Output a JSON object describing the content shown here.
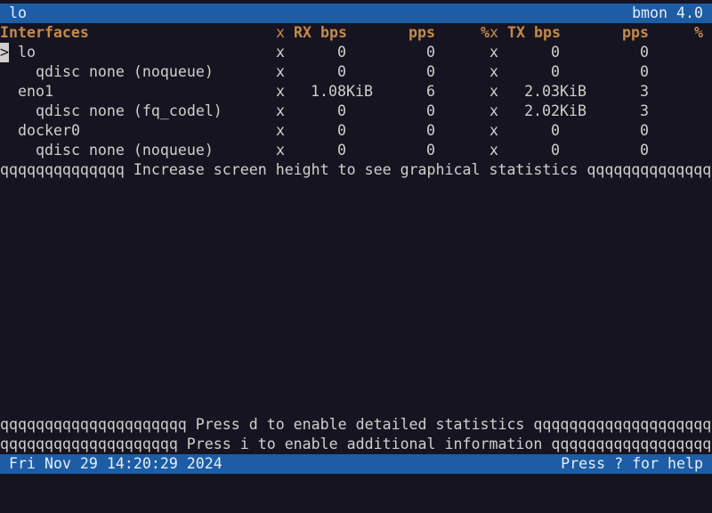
{
  "title_bar": {
    "left": "lo",
    "right": "bmon 4.0"
  },
  "header": {
    "interfaces": "Interfaces",
    "x1": "x",
    "rx_bps": "RX bps",
    "rx_pps": "pps",
    "rx_pct": "%",
    "x2": "x",
    "tx_bps": "TX bps",
    "tx_pps": "pps",
    "tx_pct": "%"
  },
  "cursor_marker": ">",
  "rows": [
    {
      "name": "lo",
      "rx_bps": "0",
      "rx_pps": "0",
      "tx_bps": "0",
      "tx_pps": "0"
    },
    {
      "name": "qdisc none (noqueue)",
      "rx_bps": "0",
      "rx_pps": "0",
      "tx_bps": "0",
      "tx_pps": "0"
    },
    {
      "name": "eno1",
      "rx_bps": "1.08KiB",
      "rx_pps": "6",
      "tx_bps": "2.03KiB",
      "tx_pps": "3"
    },
    {
      "name": "qdisc none (fq_codel)",
      "rx_bps": "0",
      "rx_pps": "0",
      "tx_bps": "2.02KiB",
      "tx_pps": "3"
    },
    {
      "name": "docker0",
      "rx_bps": "0",
      "rx_pps": "0",
      "tx_bps": "0",
      "tx_pps": "0"
    },
    {
      "name": "qdisc none (noqueue)",
      "rx_bps": "0",
      "rx_pps": "0",
      "tx_bps": "0",
      "tx_pps": "0"
    }
  ],
  "separator_x": "x",
  "messages": {
    "graph": "qqqqqqqqqqqqqq Increase screen height to see graphical statistics qqqqqqqqqqqqqqqq",
    "details": "qqqqqqqqqqqqqqqqqqqqq Press d to enable detailed statistics qqqqqqqqqqqqqqqqqqqqqqq",
    "info": "qqqqqqqqqqqqqqqqqqqq Press i to enable additional information qqqqqqqqqqqqqqqqqqqqqq"
  },
  "status_bar": {
    "datetime": "Fri Nov 29 14:20:29 2024",
    "help": "Press ? for help"
  },
  "colors": {
    "background": "#171421",
    "bar": "#1c5da5",
    "header": "#c38a4a",
    "text": "#d0cfcc"
  }
}
